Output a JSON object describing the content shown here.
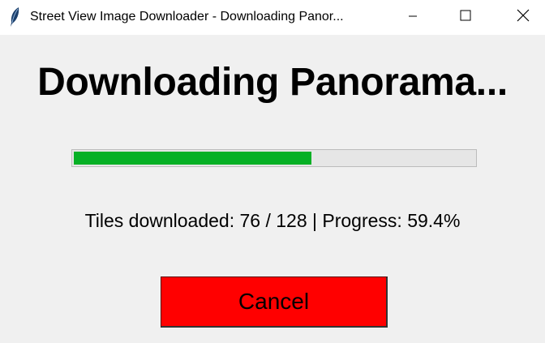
{
  "window": {
    "title": "Street View Image Downloader - Downloading Panor...",
    "controls": [
      "minimize-icon",
      "maximize-icon",
      "close-icon"
    ]
  },
  "heading": "Downloading Panorama...",
  "progress": {
    "fraction": 0.594,
    "fill_color": "#06b025"
  },
  "status": "Tiles downloaded: 76 / 128 | Progress: 59.4%",
  "cancel_button": {
    "label": "Cancel",
    "color": "#ff0000"
  }
}
